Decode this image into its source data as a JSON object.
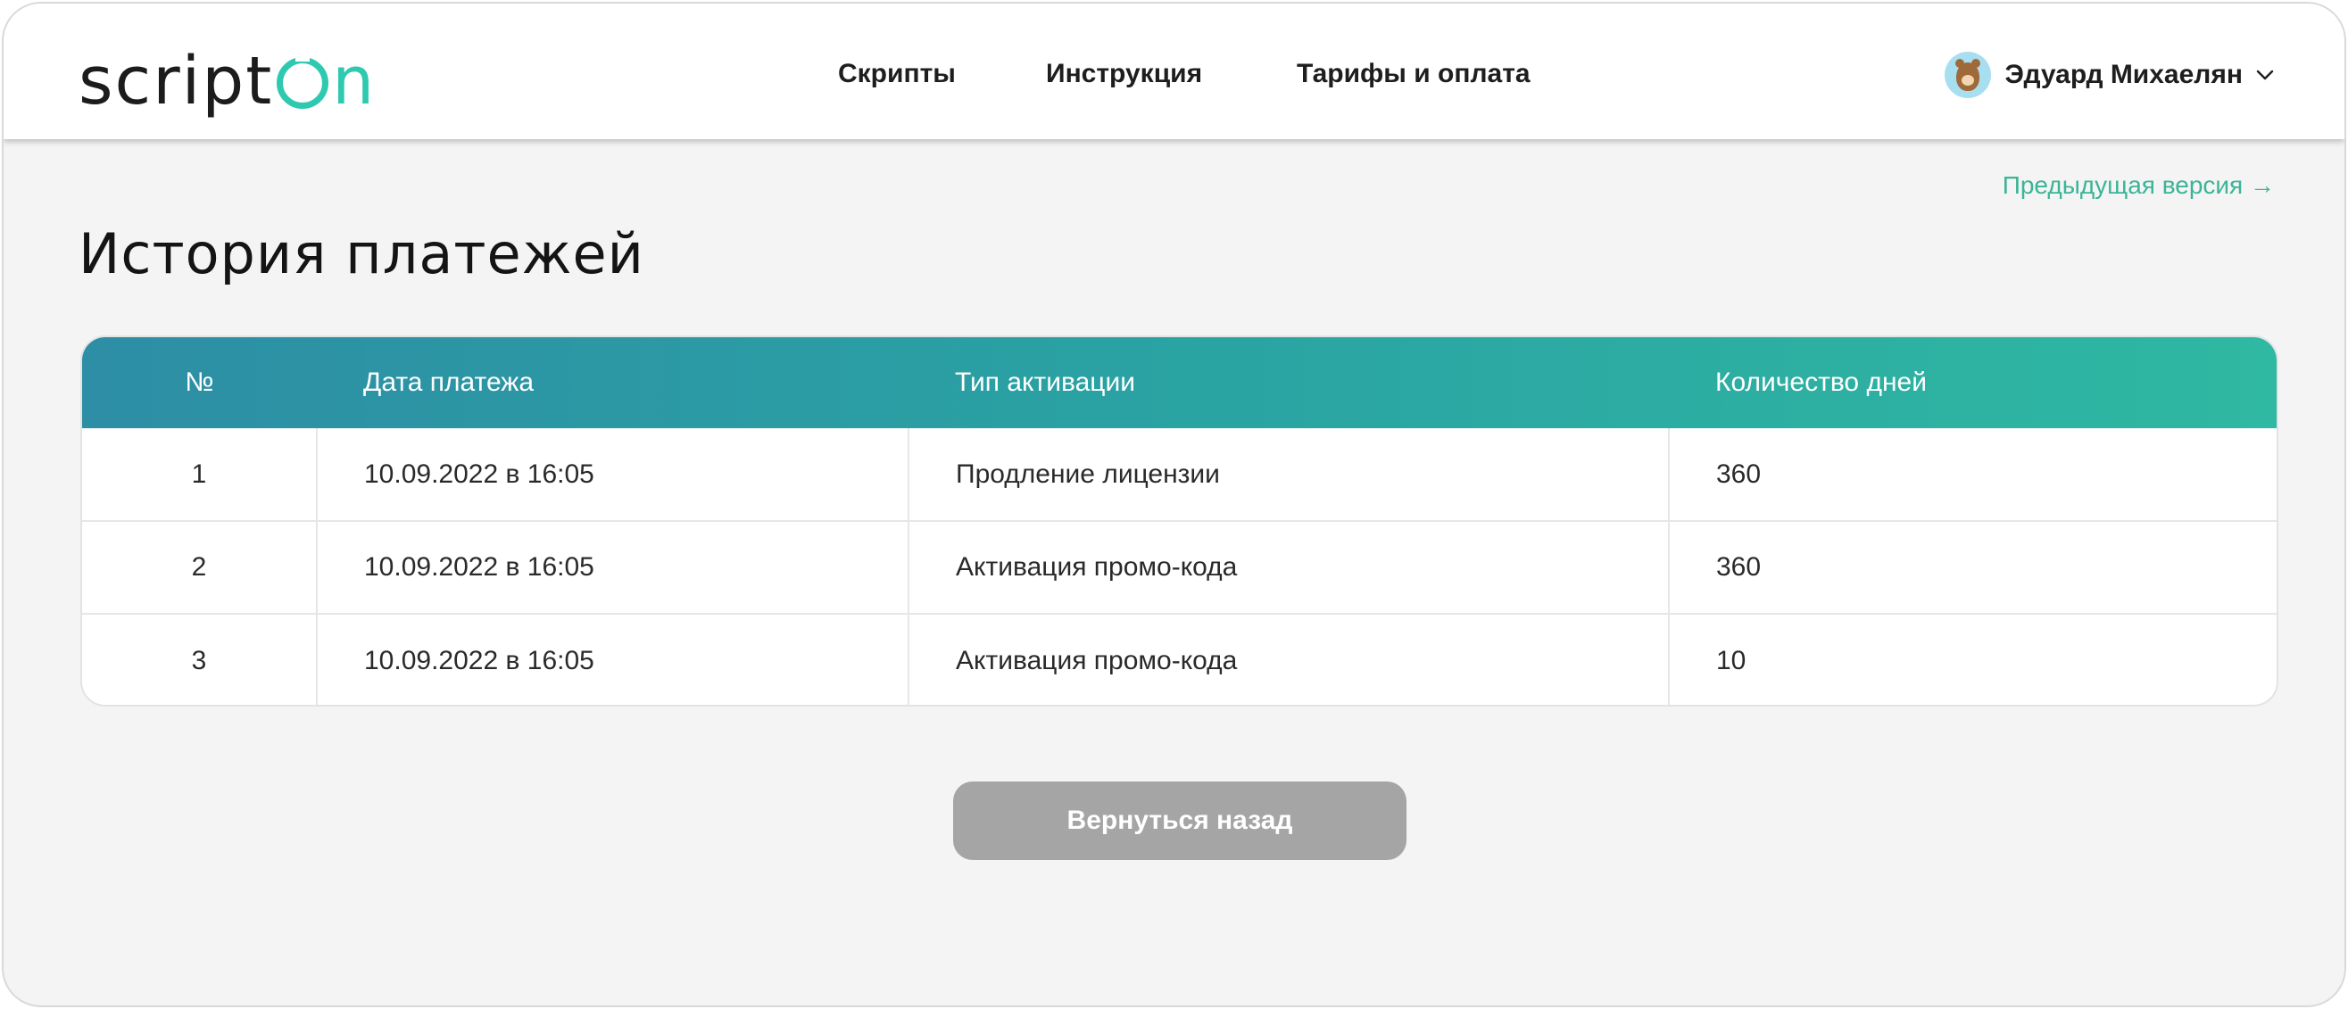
{
  "brand": {
    "logo_prefix": "script",
    "logo_suffix": "n",
    "accent_color": "#2fc9b0"
  },
  "nav": {
    "items": [
      {
        "label": "Скрипты"
      },
      {
        "label": "Инструкция"
      },
      {
        "label": "Тарифы и оплата"
      }
    ]
  },
  "user": {
    "name": "Эдуард Михаелян",
    "avatar_icon": "bear-avatar"
  },
  "links": {
    "previous_version": "Предыдущая версия →"
  },
  "page": {
    "title": "История платежей"
  },
  "table": {
    "columns": [
      "№",
      "Дата платежа",
      "Тип активации",
      "Количество дней"
    ],
    "rows": [
      {
        "num": "1",
        "date": "10.09.2022 в 16:05",
        "type": "Продление лицензии",
        "days": "360"
      },
      {
        "num": "2",
        "date": "10.09.2022 в 16:05",
        "type": "Активация промо-кода",
        "days": "360"
      },
      {
        "num": "3",
        "date": "10.09.2022 в 16:05",
        "type": "Активация промо-кода",
        "days": "10"
      }
    ]
  },
  "actions": {
    "back_label": "Вернуться назад"
  },
  "colors": {
    "header_gradient_start": "#2d8ea5",
    "header_gradient_end": "#2fb8a2",
    "link_color": "#3cb497",
    "button_disabled": "#a5a5a5"
  }
}
